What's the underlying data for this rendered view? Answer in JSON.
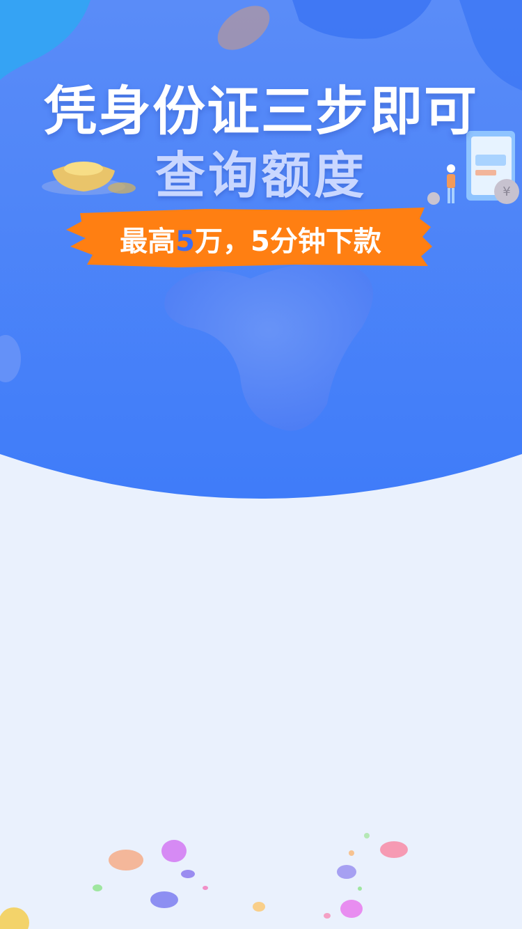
{
  "hero": {
    "headline_line1": "凭身份证三步即可",
    "headline_line2": "查询额度",
    "promo": {
      "prefix": "最高",
      "highlight": "5",
      "suffix": "万，5分钟下款"
    }
  },
  "colors": {
    "hero_top": "#5a8cf8",
    "hero_bottom": "#3f7cf9",
    "page_background": "#eaf1fd",
    "promo_brush": "#ff7f12",
    "promo_highlight": "#3a6df6"
  },
  "icons": [
    "gold-ingot-icon",
    "coin-icon",
    "document-icon",
    "person-icon",
    "confetti-icon"
  ]
}
